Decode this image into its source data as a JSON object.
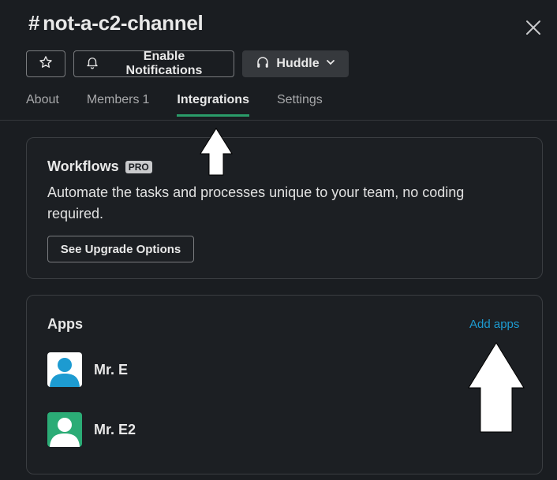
{
  "header": {
    "hash": "#",
    "channel_name": "not-a-c2-channel",
    "close_icon": "close-icon"
  },
  "toolbar": {
    "star_icon": "star-icon",
    "notifications_label": "Enable Notifications",
    "bell_icon": "bell-icon",
    "huddle_label": "Huddle",
    "headphones_icon": "headphones-icon",
    "chevron_icon": "chevron-down-icon"
  },
  "tabs": [
    {
      "label": "About"
    },
    {
      "label": "Members",
      "count": "1"
    },
    {
      "label": "Integrations",
      "active": true
    },
    {
      "label": "Settings"
    }
  ],
  "workflows": {
    "title": "Workflows",
    "badge": "PRO",
    "description": "Automate the tasks and processes unique to your team, no coding required.",
    "button_label": "See Upgrade Options"
  },
  "apps": {
    "title": "Apps",
    "add_label": "Add apps",
    "items": [
      {
        "name": "Mr. E",
        "avatar_color": "#1d9bd1"
      },
      {
        "name": "Mr. E2",
        "avatar_color": "#2bac76"
      }
    ]
  },
  "colors": {
    "accent_tab": "#2a9c69",
    "link": "#1d9bd1",
    "background": "#1a1d21"
  }
}
